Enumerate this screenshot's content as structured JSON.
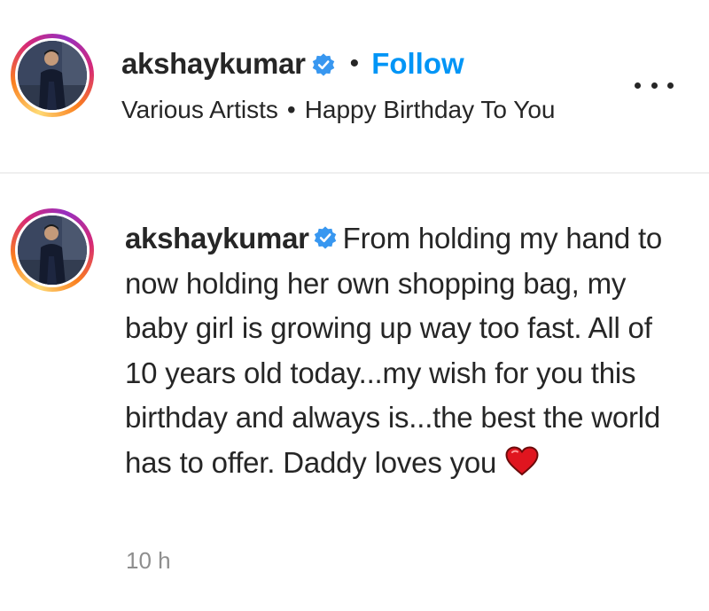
{
  "post_header": {
    "username": "akshaykumar",
    "separator": "•",
    "follow_label": "Follow",
    "audio_artist": "Various Artists",
    "audio_separator": "•",
    "audio_title": "Happy Birthday To You",
    "more_icon": "more-horizontal-icon"
  },
  "comment": {
    "username": "akshaykumar",
    "text": "From holding my hand to now holding her own shopping bag, my baby girl is growing up way too fast. All of 10 years old today...my wish for you this birthday and always is...the best the world has to offer. Daddy loves you",
    "emoji_icon": "red-heart-icon",
    "time": "10 h"
  },
  "colors": {
    "accent": "#0095f6",
    "text": "#262626",
    "muted": "#8e8e8e",
    "verified": "#3897f0",
    "heart": "#e0151f"
  }
}
